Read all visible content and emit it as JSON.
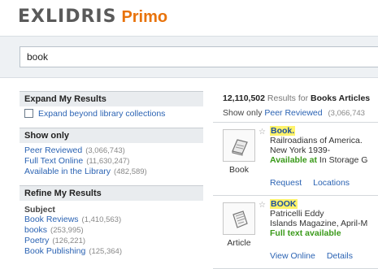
{
  "header": {
    "brand": "EXLIDRIS",
    "product": "Primo"
  },
  "search": {
    "query": "book"
  },
  "sidebar": {
    "expand": {
      "title": "Expand My Results",
      "checkbox_label": "Expand beyond library collections"
    },
    "show_only": {
      "title": "Show only",
      "items": [
        {
          "label": "Peer Reviewed",
          "count": "(3,066,743)"
        },
        {
          "label": "Full Text Online",
          "count": "(11,630,247)"
        },
        {
          "label": "Available in the Library",
          "count": "(482,589)"
        }
      ]
    },
    "refine": {
      "title": "Refine My Results",
      "subject_label": "Subject",
      "items": [
        {
          "label": "Book Reviews",
          "count": "(1,410,563)"
        },
        {
          "label": "books",
          "count": "(253,995)"
        },
        {
          "label": "Poetry",
          "count": "(126,221)"
        },
        {
          "label": "Book Publishing",
          "count": "(125,364)"
        }
      ]
    }
  },
  "results": {
    "count": "12,110,502",
    "results_for": "Results for",
    "scope": "Books Articles",
    "show_only_label": "Show only",
    "peer_reviewed": "Peer Reviewed",
    "peer_reviewed_count": "(3,066,743",
    "items": [
      {
        "type": "Book",
        "title": "Book.",
        "line1": "Railroadians of America.",
        "line2": "New York 1939-",
        "availability": "Available at",
        "location": "In Storage G",
        "actions": [
          "Request",
          "Locations"
        ]
      },
      {
        "type": "Article",
        "title": "BOOK",
        "line1": "Patricelli Eddy",
        "line2": "Islands Magazine, April-M",
        "availability": "Full text available",
        "actions": [
          "View Online",
          "Details"
        ]
      }
    ]
  },
  "colors": {
    "link": "#2b63b3",
    "brand_orange": "#e8730c",
    "available_green": "#3a9a1a",
    "highlight": "#fff36b"
  },
  "icons": [
    "book-icon",
    "article-icon",
    "star-icon",
    "checkbox"
  ]
}
